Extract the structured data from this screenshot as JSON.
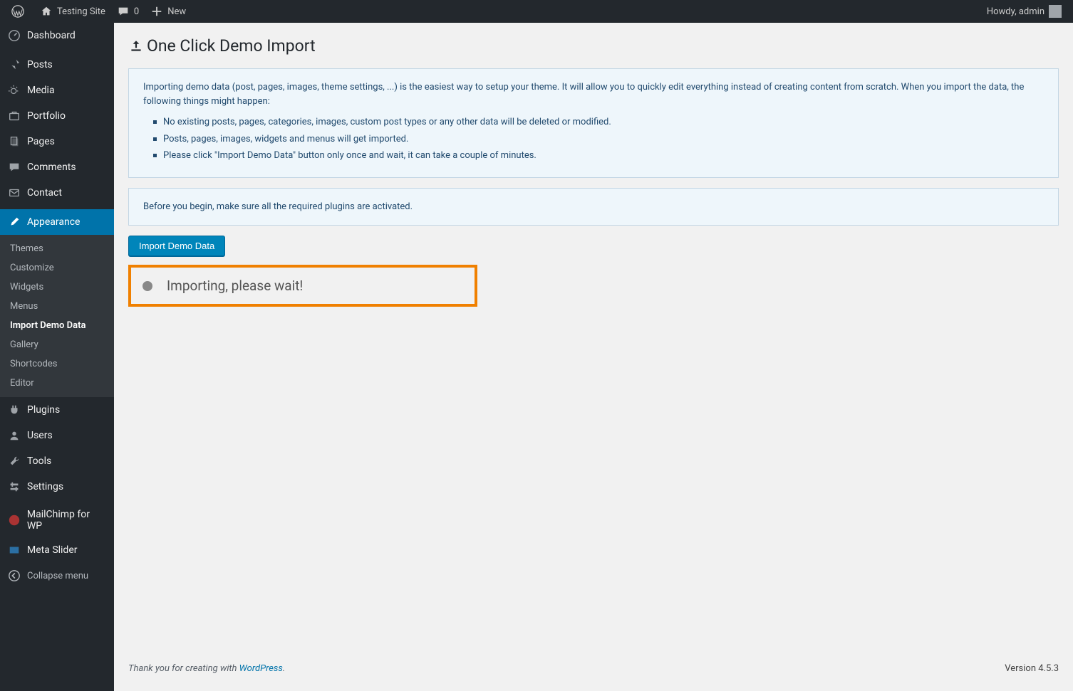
{
  "toolbar": {
    "site_name": "Testing Site",
    "comment_count": "0",
    "new_label": "New",
    "howdy": "Howdy, admin"
  },
  "sidebar": {
    "items": [
      {
        "label": "Dashboard"
      },
      {
        "label": "Posts"
      },
      {
        "label": "Media"
      },
      {
        "label": "Portfolio"
      },
      {
        "label": "Pages"
      },
      {
        "label": "Comments"
      },
      {
        "label": "Contact"
      },
      {
        "label": "Appearance"
      },
      {
        "label": "Plugins"
      },
      {
        "label": "Users"
      },
      {
        "label": "Tools"
      },
      {
        "label": "Settings"
      },
      {
        "label": "MailChimp for WP"
      },
      {
        "label": "Meta Slider"
      }
    ],
    "submenu": [
      {
        "label": "Themes"
      },
      {
        "label": "Customize"
      },
      {
        "label": "Widgets"
      },
      {
        "label": "Menus"
      },
      {
        "label": "Import Demo Data"
      },
      {
        "label": "Gallery"
      },
      {
        "label": "Shortcodes"
      },
      {
        "label": "Editor"
      }
    ],
    "collapse_label": "Collapse menu"
  },
  "page": {
    "title": "One Click Demo Import",
    "intro": "Importing demo data (post, pages, images, theme settings, ...) is the easiest way to setup your theme. It will allow you to quickly edit everything instead of creating content from scratch. When you import the data, the following things might happen:",
    "bullets": [
      "No existing posts, pages, categories, images, custom post types or any other data will be deleted or modified.",
      "Posts, pages, images, widgets and menus will get imported.",
      "Please click \"Import Demo Data\" button only once and wait, it can take a couple of minutes."
    ],
    "before_begin": "Before you begin, make sure all the required plugins are activated.",
    "import_button": "Import Demo Data",
    "import_status": "Importing, please wait!"
  },
  "footer": {
    "thanks_prefix": "Thank you for creating with ",
    "wordpress": "WordPress",
    "thanks_suffix": ".",
    "version": "Version 4.5.3"
  }
}
